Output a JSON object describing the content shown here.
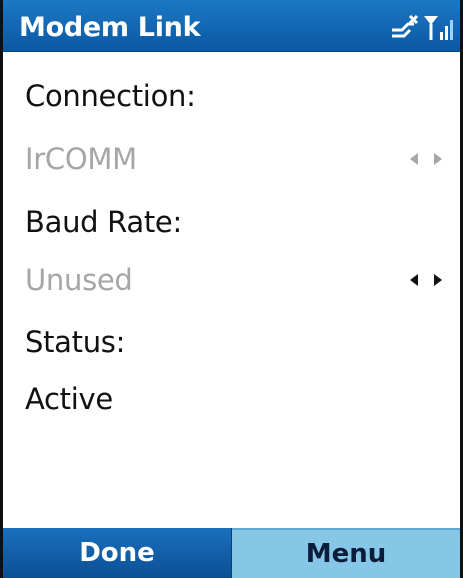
{
  "window": {
    "title": "Modem Link"
  },
  "status_bar": {
    "icons": [
      "connection-off-icon",
      "signal-strength-icon"
    ],
    "accent": "#0b58a3"
  },
  "form": {
    "connection": {
      "label": "Connection:",
      "value": "IrCOMM",
      "enabled": false
    },
    "baud_rate": {
      "label": "Baud Rate:",
      "value": "Unused",
      "enabled": true
    },
    "status": {
      "label": "Status:",
      "value": "Active"
    }
  },
  "softkeys": {
    "left": "Done",
    "right": "Menu"
  }
}
